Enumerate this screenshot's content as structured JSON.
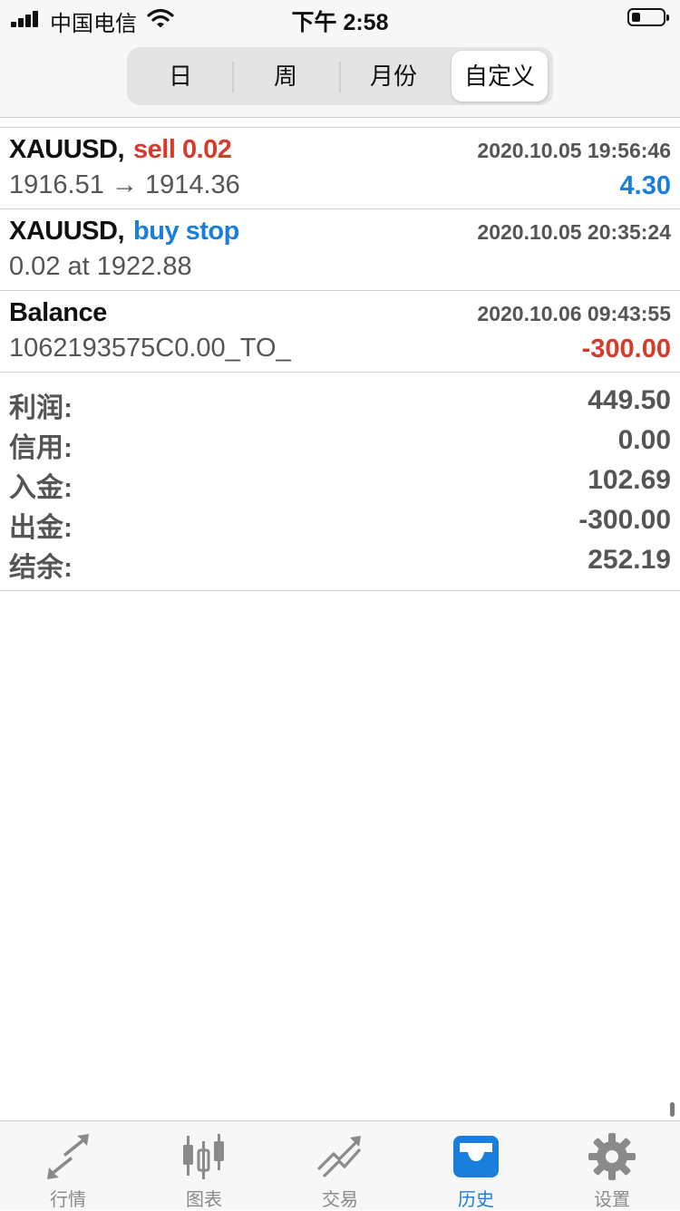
{
  "status_bar": {
    "carrier": "中国电信",
    "time": "下午 2:58"
  },
  "segments": [
    {
      "label": "日",
      "active": false
    },
    {
      "label": "周",
      "active": false
    },
    {
      "label": "月份",
      "active": false
    },
    {
      "label": "自定义",
      "active": true
    }
  ],
  "history": [
    {
      "symbol": "XAUUSD,",
      "action": "sell 0.02",
      "action_color": "#d63a2a",
      "date": "2020.10.05 19:56:46",
      "detail": "1916.51 → 1914.36",
      "amount": "4.30",
      "amount_color": "#1a7fdc"
    },
    {
      "symbol": "XAUUSD,",
      "action": "buy stop",
      "action_color": "#1a7fdc",
      "date": "2020.10.05 20:35:24",
      "detail": "0.02 at 1922.88",
      "amount": "",
      "amount_color": "#111111"
    },
    {
      "symbol": "Balance",
      "action": "",
      "action_color": "#111111",
      "date": "2020.10.06 09:43:55",
      "detail": "1062193575C0.00_TO_",
      "amount": "-300.00",
      "amount_color": "#d63a2a"
    }
  ],
  "summary": [
    {
      "label": "利润:",
      "value": "449.50"
    },
    {
      "label": "信用:",
      "value": "0.00"
    },
    {
      "label": "入金:",
      "value": "102.69"
    },
    {
      "label": "出金:",
      "value": "-300.00"
    },
    {
      "label": "结余:",
      "value": "252.19"
    }
  ],
  "tabs": [
    {
      "label": "行情",
      "icon": "quotes-arrows-icon",
      "active": false
    },
    {
      "label": "图表",
      "icon": "candlestick-chart-icon",
      "active": false
    },
    {
      "label": "交易",
      "icon": "trade-trend-icon",
      "active": false
    },
    {
      "label": "历史",
      "icon": "history-inbox-icon",
      "active": true
    },
    {
      "label": "设置",
      "icon": "gear-icon",
      "active": false
    }
  ],
  "colors": {
    "sell": "#d63a2a",
    "buy": "#1a7fdc",
    "tab_active": "#1a7fdc",
    "tab_inactive": "#8a8a8a"
  }
}
